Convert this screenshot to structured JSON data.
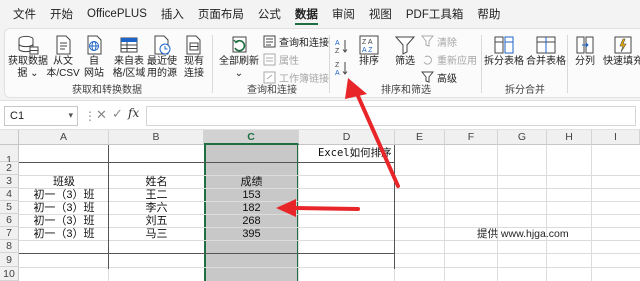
{
  "menu": {
    "tabs": [
      "文件",
      "开始",
      "OfficePLUS",
      "插入",
      "页面布局",
      "公式",
      "数据",
      "审阅",
      "视图",
      "PDF工具箱",
      "帮助"
    ],
    "active": "数据"
  },
  "ribbon": {
    "get_data": {
      "label": "获取和转换数据",
      "buttons": [
        {
          "label": "获取数据",
          "sub": "据 ⌄",
          "icon": "database-icon"
        },
        {
          "label": "从文",
          "sub": "本/CSV",
          "icon": "text-file-icon"
        },
        {
          "label": "自",
          "sub": "网站",
          "icon": "web-icon"
        },
        {
          "label": "来自表",
          "sub": "格/区域",
          "icon": "table-icon"
        },
        {
          "label": "最近使",
          "sub": "用的源",
          "icon": "recent-source-icon"
        },
        {
          "label": "现有",
          "sub": "连接",
          "icon": "existing-connection-icon"
        }
      ]
    },
    "queries": {
      "label": "查询和连接",
      "refresh_all": {
        "label": "全部刷新",
        "sub": "⌄"
      },
      "queries_connections": "查询和连接",
      "properties": "属性",
      "edit_links": "工作簿链接"
    },
    "sort_filter": {
      "label": "排序和筛选",
      "sort_az": "A↓Z",
      "sort_za": "Z↓A",
      "sort": "排序",
      "filter": "筛选",
      "clear": "清除",
      "reapply": "重新应用",
      "advanced": "高级"
    },
    "data_tools": {
      "label": "拆分合并",
      "split_table": "拆分表格",
      "merge_table": "合并表格"
    },
    "extra": {
      "split": "分列",
      "flash_fill": "快速填充"
    }
  },
  "formula_bar": {
    "name_box": "C1",
    "fx": "fx",
    "cancel": "✕",
    "enter": "✓",
    "formula": ""
  },
  "sheet": {
    "columns": [
      "A",
      "B",
      "C",
      "D",
      "E",
      "F",
      "G",
      "H",
      "I"
    ],
    "selected_column": "C",
    "rows": [
      "1",
      "2",
      "3",
      "4",
      "5",
      "6",
      "7",
      "8",
      "9",
      "10"
    ],
    "title": "Excel如何排序",
    "headers": {
      "class": "班级",
      "name": "姓名",
      "score": "成绩"
    },
    "data": [
      {
        "class": "初一（3）班",
        "name": "王二",
        "score": "153"
      },
      {
        "class": "初一（3）班",
        "name": "李六",
        "score": "182"
      },
      {
        "class": "初一（3）班",
        "name": "刘五",
        "score": "268"
      },
      {
        "class": "初一（3）班",
        "name": "马三",
        "score": "395"
      }
    ],
    "watermark": "提供 www.hjga.com"
  },
  "colors": {
    "accent_green": "#1d6f42",
    "annotation_red": "#e8262a",
    "selected_column_fill": "#c8c8c8"
  }
}
